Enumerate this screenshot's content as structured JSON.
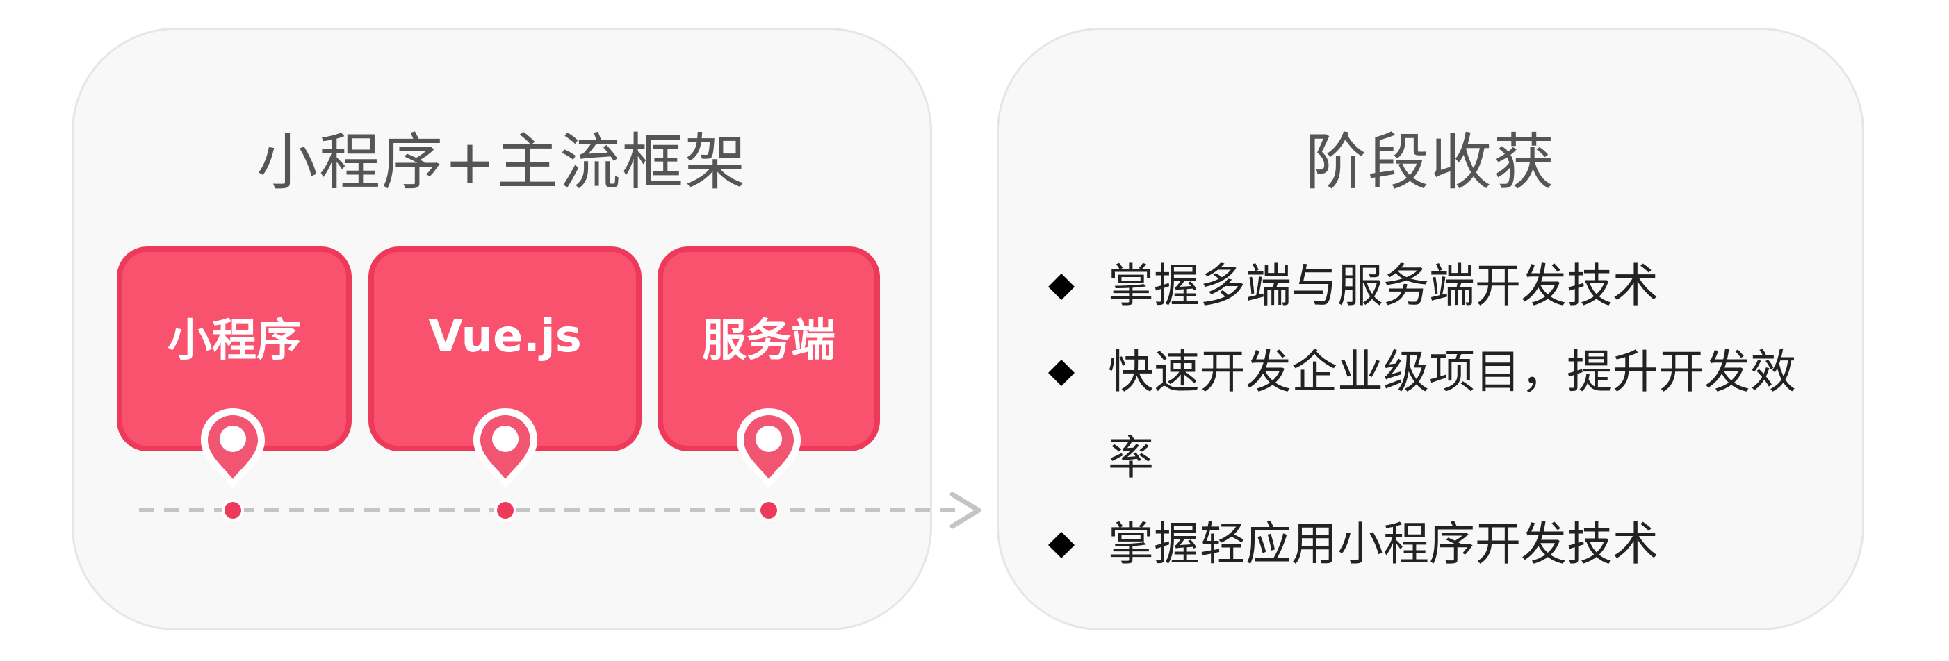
{
  "left_panel": {
    "title": "小程序+主流框架",
    "cards": [
      {
        "label": "小程序"
      },
      {
        "label": "Vue.js"
      },
      {
        "label": "服务端"
      }
    ]
  },
  "right_panel": {
    "title": "阶段收获",
    "bullets": [
      "掌握多端与服务端开发技术",
      "快速开发企业级项目，提升开发效率",
      "掌握轻应用小程序开发技术"
    ]
  },
  "colors": {
    "card_fill": "#f9526f",
    "card_border": "#ee3a5a",
    "panel_bg": "#f8f8f8",
    "timeline": "#c4c4c4"
  }
}
